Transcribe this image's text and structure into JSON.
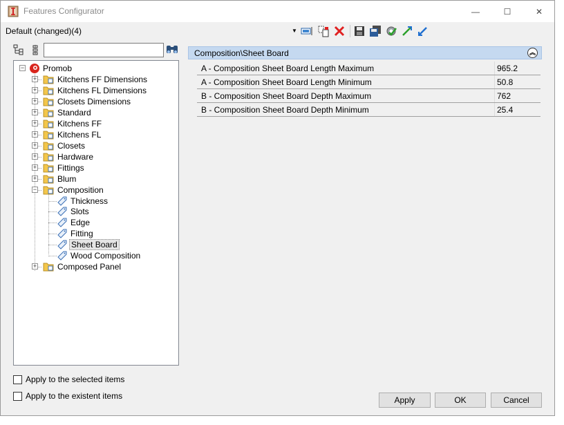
{
  "window": {
    "title": "Features Configurator",
    "minimize_glyph": "—",
    "maximize_glyph": "☐",
    "close_glyph": "✕"
  },
  "toolbar": {
    "profile": "Default (changed)(4)",
    "dropdown_glyph": "▼",
    "icons": [
      "properties-icon",
      "copy-icon",
      "delete-icon",
      "save-icon",
      "save-as-icon",
      "settings-icon",
      "import-icon",
      "export-icon"
    ]
  },
  "search": {
    "value": "",
    "placeholder": ""
  },
  "tree": {
    "root": "Promob",
    "items": [
      {
        "label": "Kitchens FF Dimensions",
        "expanded": false
      },
      {
        "label": "Kitchens FL Dimensions",
        "expanded": false
      },
      {
        "label": "Closets Dimensions",
        "expanded": false
      },
      {
        "label": "Standard",
        "expanded": false
      },
      {
        "label": "Kitchens FF",
        "expanded": false
      },
      {
        "label": "Kitchens FL",
        "expanded": false
      },
      {
        "label": "Closets",
        "expanded": false
      },
      {
        "label": "Hardware",
        "expanded": false
      },
      {
        "label": "Fittings",
        "expanded": false
      },
      {
        "label": "Blum",
        "expanded": false
      },
      {
        "label": "Composition",
        "expanded": true
      },
      {
        "label": "Composed Panel",
        "expanded": false
      }
    ],
    "composition_children": [
      "Thickness",
      "Slots",
      "Edge",
      "Fitting",
      "Sheet Board",
      "Wood Composition"
    ],
    "selected": "Sheet Board"
  },
  "options": {
    "apply_selected": "Apply to the selected items",
    "apply_existent": "Apply to the existent items"
  },
  "panel": {
    "title": "Composition\\Sheet Board",
    "collapse_glyph": "︽",
    "rows": [
      {
        "name": "A - Composition Sheet Board Length Maximum",
        "value": "965.2"
      },
      {
        "name": "A - Composition Sheet Board Length Minimum",
        "value": "50.8"
      },
      {
        "name": "B - Composition Sheet Board Depth Maximum",
        "value": "762"
      },
      {
        "name": "B - Composition Sheet Board Depth Minimum",
        "value": "25.4"
      }
    ]
  },
  "buttons": {
    "apply": "Apply",
    "ok": "OK",
    "cancel": "Cancel"
  },
  "colors": {
    "panel_header": "#c5d9f0",
    "delete_red": "#e02020",
    "folder_yellow": "#f3c64a",
    "root_red": "#d9251d"
  }
}
